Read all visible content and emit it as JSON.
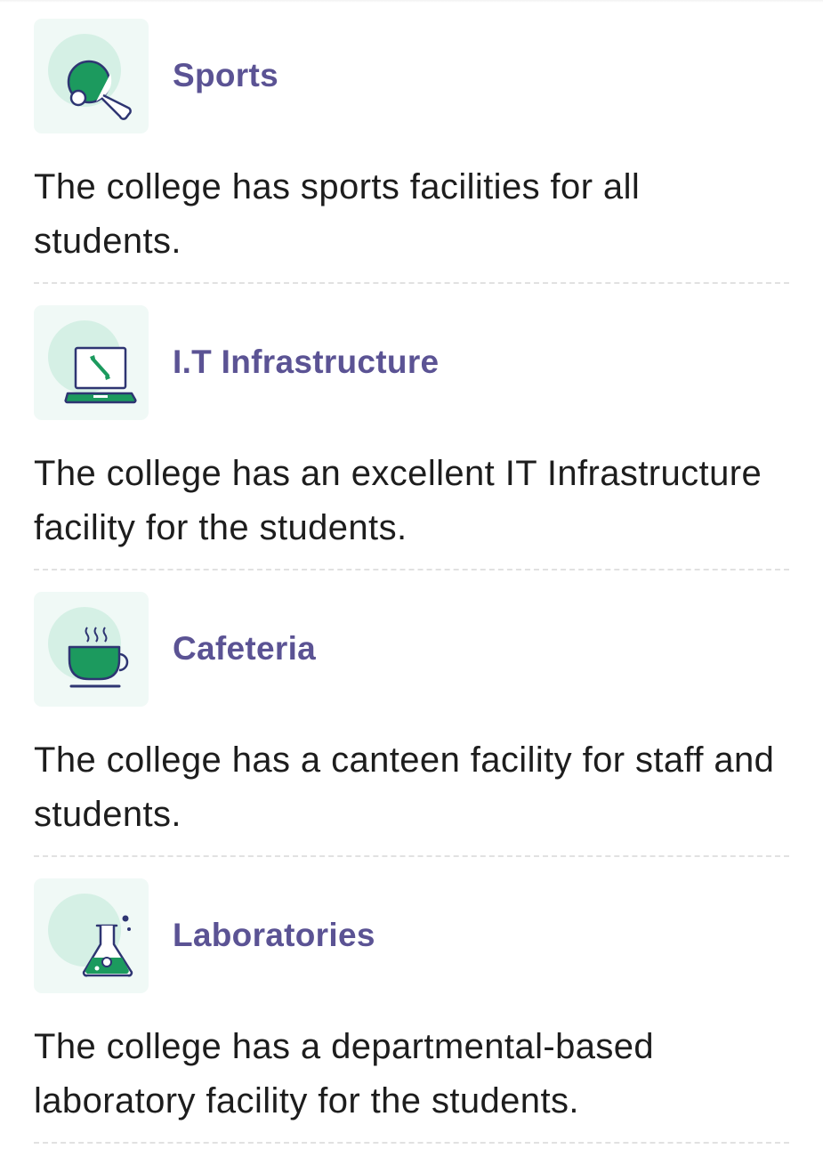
{
  "facilities": [
    {
      "icon": "ping-pong-paddle-icon",
      "title": "Sports",
      "description": "The college has sports facilities for all students."
    },
    {
      "icon": "laptop-wrench-icon",
      "title": "I.T Infrastructure",
      "description": "The college has an excellent IT Infrastructure facility for the students."
    },
    {
      "icon": "coffee-cup-icon",
      "title": "Cafeteria",
      "description": "The college has a canteen facility for staff and students."
    },
    {
      "icon": "lab-flask-icon",
      "title": "Laboratories",
      "description": "The college has a departmental-based laboratory facility for the students."
    }
  ],
  "colors": {
    "title": "#5b5394",
    "icon_green": "#1c9a5e",
    "icon_outline": "#2e3572",
    "tile_bg": "#f0f9f6",
    "tile_blob": "#d5f0e5",
    "body_text": "#1d1d1d",
    "divider": "#e1e1e1"
  }
}
